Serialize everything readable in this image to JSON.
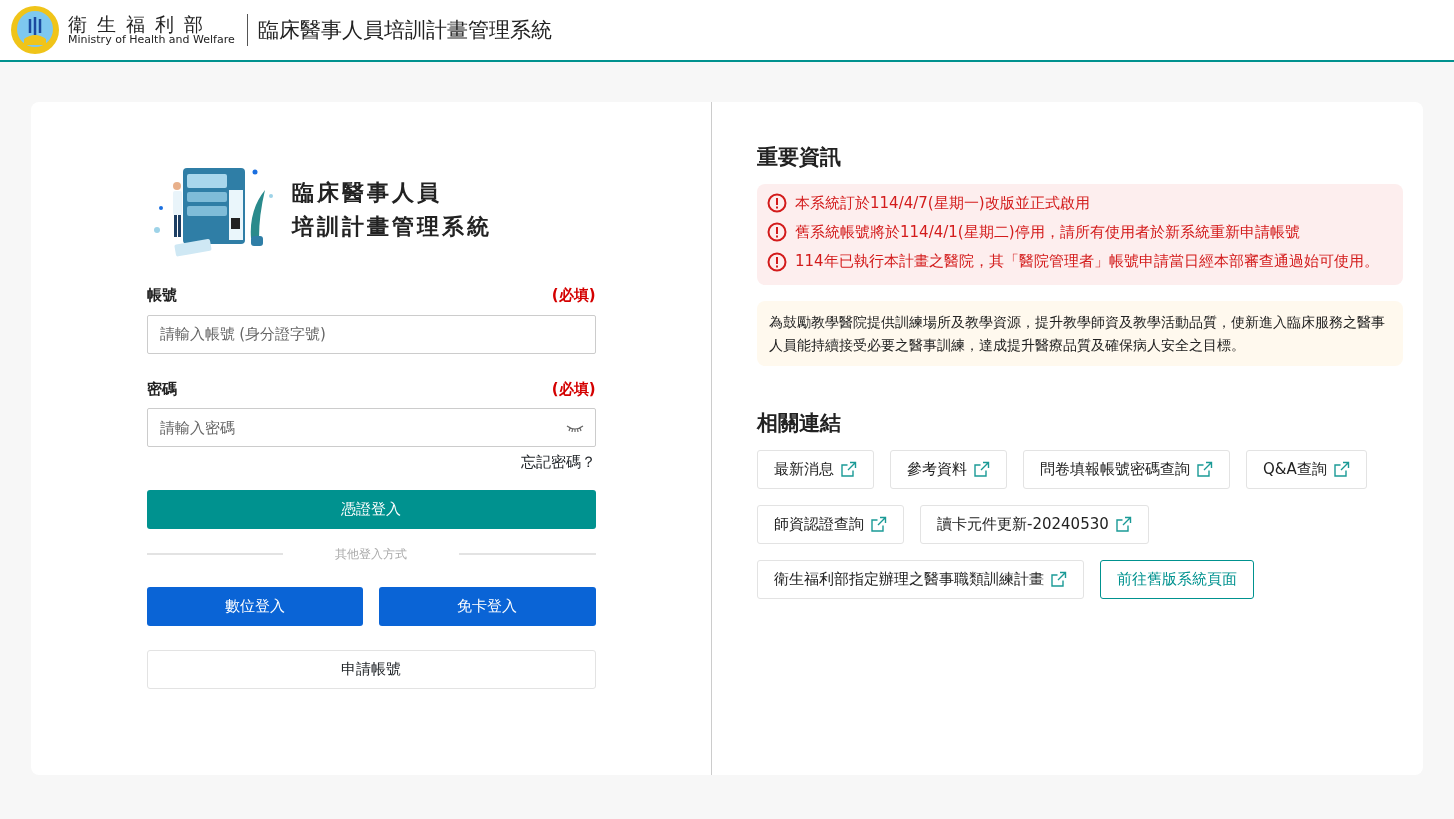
{
  "header": {
    "org_name": "衛 生 福 利 部",
    "org_name_en": "Ministry of Health and Welfare",
    "system_title": "臨床醫事人員培訓計畫管理系統"
  },
  "login": {
    "hero_title_lines": [
      "臨床醫事人員",
      "培訓計畫管理系統"
    ],
    "fields": [
      {
        "kind": "text",
        "label": "帳號",
        "required": "(必填)",
        "placeholder": "請輸入帳號 (身分證字號)"
      },
      {
        "kind": "password",
        "label": "密碼",
        "required": "(必填)",
        "placeholder": "請輸入密碼"
      }
    ],
    "forgot_link": "忘記密碼？",
    "primary_button": "憑證登入",
    "divider_text": "其他登入方式",
    "alt_buttons": [
      "數位登入",
      "免卡登入"
    ],
    "apply_button": "申請帳號"
  },
  "info": {
    "title": "重要資訊",
    "alerts": [
      "本系統訂於114/4/7(星期一)改版並正式啟用",
      "舊系統帳號將於114/4/1(星期二)停用，請所有使用者於新系統重新申請帳號",
      "114年已執行本計畫之醫院，其「醫院管理者」帳號申請當日經本部審查通過始可使用。"
    ],
    "description": "為鼓勵教學醫院提供訓練場所及教學資源，提升教學師資及教學活動品質，使新進入臨床服務之醫事人員能持續接受必要之醫事訓練，達成提升醫療品質及確保病人安全之目標。"
  },
  "links": {
    "title": "相關連結",
    "rows": [
      [
        {
          "kind": "external",
          "label": "最新消息"
        },
        {
          "kind": "external",
          "label": "參考資料"
        },
        {
          "kind": "external",
          "label": "問卷填報帳號密碼查詢"
        },
        {
          "kind": "external",
          "label": "Q&A查詢"
        }
      ],
      [
        {
          "kind": "external",
          "label": "師資認證查詢"
        },
        {
          "kind": "external",
          "label": "讀卡元件更新-20240530"
        }
      ],
      [
        {
          "kind": "external",
          "label": "衛生福利部指定辦理之醫事職類訓練計畫"
        },
        {
          "kind": "outline",
          "label": "前往舊版系統頁面"
        }
      ]
    ]
  }
}
